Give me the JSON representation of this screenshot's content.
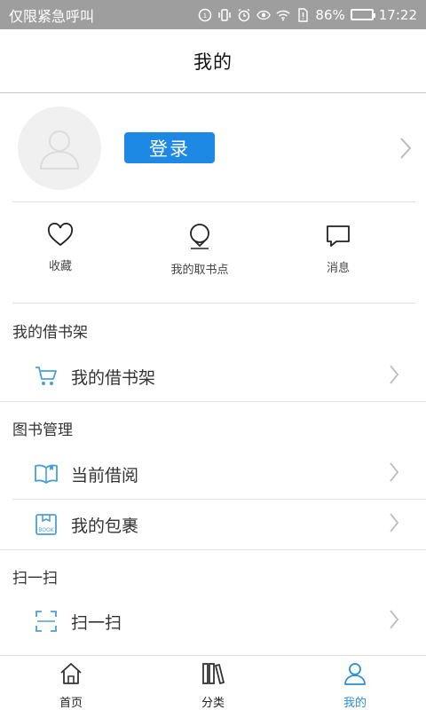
{
  "status_bar": {
    "carrier": "仅限紧急呼叫",
    "battery_percent": "86%",
    "battery_level": 0.86,
    "time": "17:22",
    "icons": [
      "hd-icon",
      "vibrate-icon",
      "alarm-icon",
      "eye-icon",
      "wifi-icon",
      "sim-icon",
      "battery-icon"
    ]
  },
  "header": {
    "title": "我的"
  },
  "profile": {
    "login_label": "登录",
    "avatar_icon": "user-avatar-icon"
  },
  "quick_actions": [
    {
      "label": "收藏",
      "icon": "heart-icon"
    },
    {
      "label": "我的取书点",
      "icon": "location-pin-icon"
    },
    {
      "label": "消息",
      "icon": "chat-bubble-icon"
    }
  ],
  "sections": {
    "bookshelf": {
      "title": "我的借书架",
      "items": [
        {
          "label": "我的借书架",
          "icon": "cart-icon"
        }
      ]
    },
    "book_management": {
      "title": "图书管理",
      "items": [
        {
          "label": "当前借阅",
          "icon": "open-book-icon"
        },
        {
          "label": "我的包裹",
          "icon": "package-box-icon",
          "icon_text": "BOOK"
        }
      ]
    },
    "scan": {
      "title": "扫一扫",
      "items": [
        {
          "label": "扫一扫",
          "icon": "scan-frame-icon"
        }
      ]
    }
  },
  "bottom_nav": [
    {
      "label": "首页",
      "icon": "home-icon",
      "active": false
    },
    {
      "label": "分类",
      "icon": "books-icon",
      "active": false
    },
    {
      "label": "我的",
      "icon": "user-icon",
      "active": true
    }
  ],
  "colors": {
    "accent": "#2b8fd6",
    "login_button": "#1e88e5",
    "status_bar": "#9e9e9e",
    "icon_blue": "#4a9fd8"
  }
}
